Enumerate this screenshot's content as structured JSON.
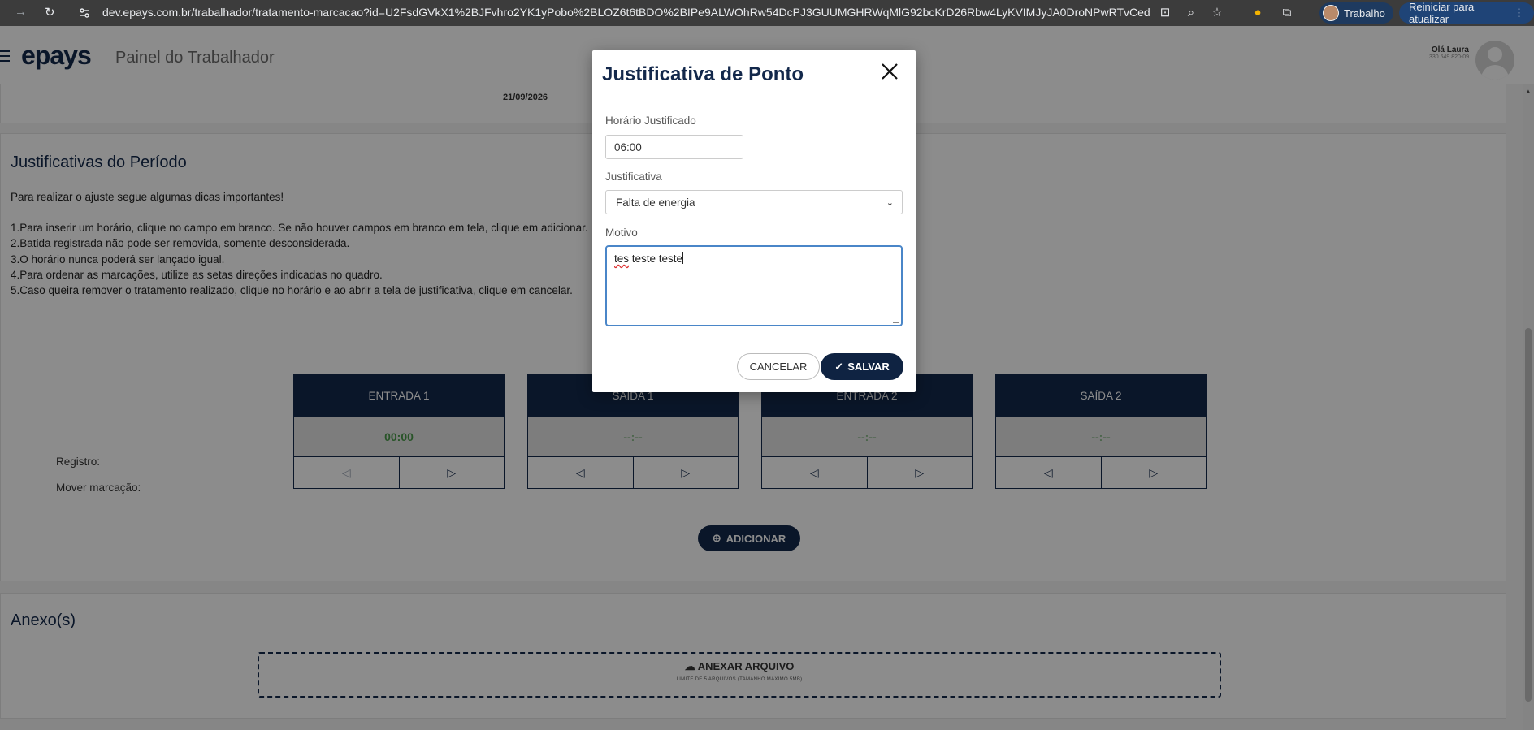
{
  "browser": {
    "url": "dev.epays.com.br/trabalhador/tratamento-marcacao?id=U2FsdGVkX1%2BJFvhro2YK1yPobo%2BLOZ6t6tBDO%2BIPe9ALWOhRw54DcPJ3GUUMGHRWqMlG92bcKrD26Rbw4LyKVIMJyJA0DroNPwRTvCedIkYw5e...",
    "profile_label": "Trabalho",
    "update_label": "Reiniciar para atualizar"
  },
  "header": {
    "logo": "epays",
    "panel_title": "Painel do Trabalhador",
    "greeting": "Olá Laura",
    "cpf": "330.549.820-09"
  },
  "top_card": {
    "date": "21/09/2026"
  },
  "justifications": {
    "title": "Justificativas do Período",
    "lead": "Para realizar o ajuste segue algumas dicas importantes!",
    "tips": [
      "1.Para inserir um horário, clique no campo em branco. Se não houver campos em branco em tela, clique em adicionar.",
      "2.Batida registrada não pode ser removida, somente desconsiderada.",
      "3.O horário nunca poderá ser lançado igual.",
      "4.Para ordenar as marcações, utilize as setas direções indicadas no quadro.",
      "5.Caso queira remover o tratamento realizado, clique no horário e ao abrir a tela de justificativa, clique em cancelar."
    ],
    "row_labels": {
      "registro": "Registro:",
      "mover": "Mover marcação:"
    },
    "columns": [
      {
        "header": "ENTRADA 1",
        "value": "00:00"
      },
      {
        "header": "SAÍDA 1",
        "value": "--:--"
      },
      {
        "header": "ENTRADA 2",
        "value": "--:--"
      },
      {
        "header": "SAÍDA 2",
        "value": "--:--"
      }
    ],
    "add_label": "ADICIONAR"
  },
  "annex": {
    "title": "Anexo(s)",
    "attach_label": "ANEXAR ARQUIVO",
    "limit_text": "LIMITE DE 5 ARQUIVOS (TAMANHO MÁXIMO 5MB)"
  },
  "modal": {
    "title": "Justificativa de Ponto",
    "time_label": "Horário Justificado",
    "time_value": "06:00",
    "reason_label": "Justificativa",
    "reason_value": "Falta de energia",
    "motive_label": "Motivo",
    "motive_value_misspelled": "tes",
    "motive_value_rest": " teste teste",
    "cancel_label": "CANCELAR",
    "save_label": "SALVAR"
  },
  "colors": {
    "brand_navy": "#13284b",
    "registered_green": "#4a9a4a",
    "focus_blue": "#4a86c8"
  }
}
